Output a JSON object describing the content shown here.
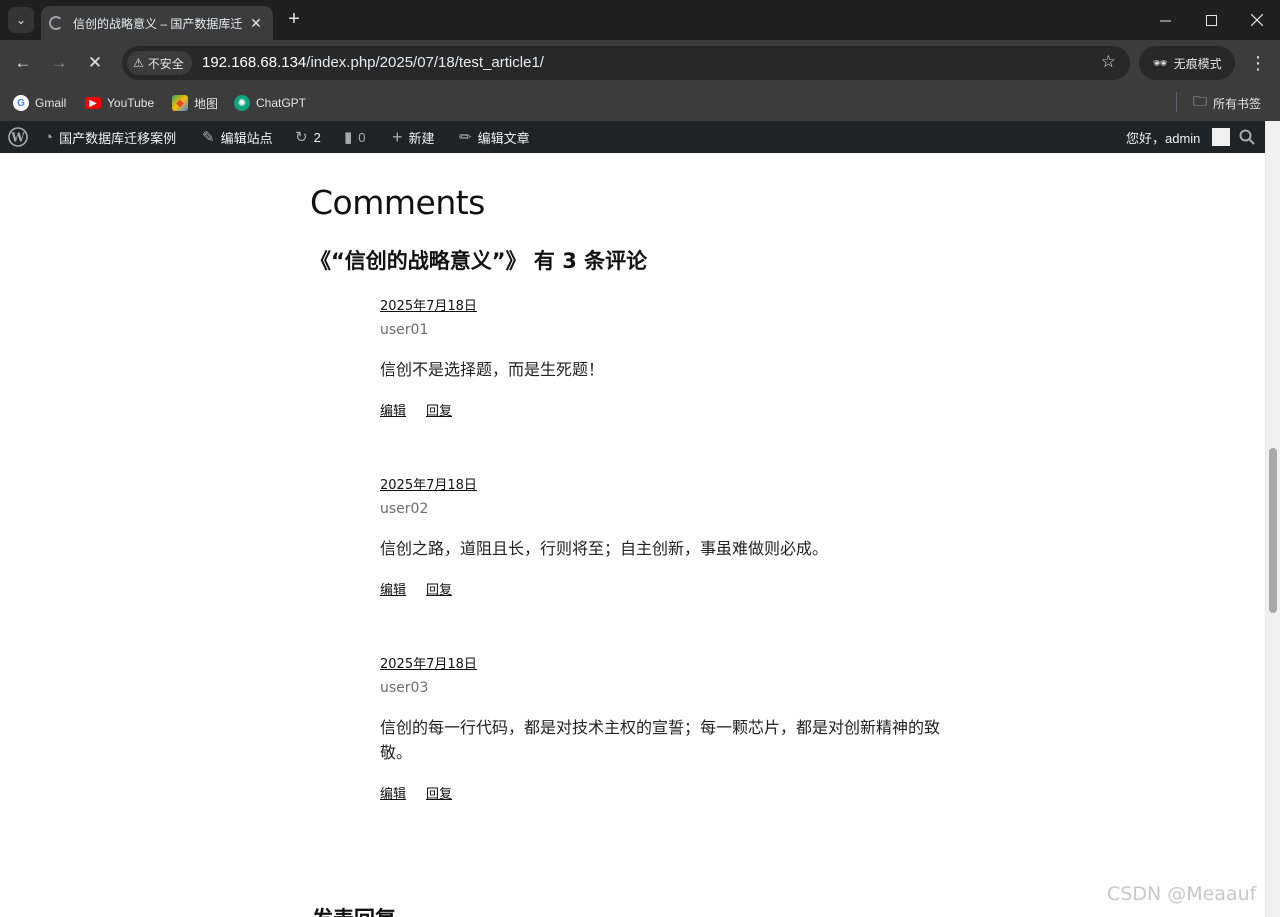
{
  "browser": {
    "tab_title": "信创的战略意义 – 国产数据库迁",
    "url_host": "192.168.68.134",
    "url_path": "/index.php/2025/07/18/test_article1/",
    "security_label": "不安全",
    "incognito_label": "无痕模式",
    "bookmarks": [
      {
        "label": "Gmail",
        "icon": "gmail-icon"
      },
      {
        "label": "YouTube",
        "icon": "youtube-icon"
      },
      {
        "label": "地图",
        "icon": "maps-icon"
      },
      {
        "label": "ChatGPT",
        "icon": "chatgpt-icon"
      }
    ],
    "all_bookmarks_label": "所有书签"
  },
  "adminbar": {
    "site_name": "国产数据库迁移案例",
    "customize": "编辑站点",
    "updates_count": "2",
    "comments_count": "0",
    "new_label": "新建",
    "edit_post": "编辑文章",
    "greeting": "您好，admin"
  },
  "main": {
    "comments_title": "Comments",
    "comments_count_text": "《“信创的战略意义”》 有 3 条评论",
    "comments": [
      {
        "date": "2025年7月18日",
        "author": "user01",
        "text": "信创不是选择题，而是生死题！",
        "edit": "编辑",
        "reply": "回复"
      },
      {
        "date": "2025年7月18日",
        "author": "user02",
        "text": "信创之路，道阻且长，行则将至；自主创新，事虽难做则必成。",
        "edit": "编辑",
        "reply": "回复"
      },
      {
        "date": "2025年7月18日",
        "author": "user03",
        "text": "信创的每一行代码，都是对技术主权的宣誓；每一颗芯片，都是对创新精神的致敬。",
        "edit": "编辑",
        "reply": "回复"
      }
    ],
    "reply_title": "发表回复"
  },
  "watermark": "CSDN @Meaauf"
}
